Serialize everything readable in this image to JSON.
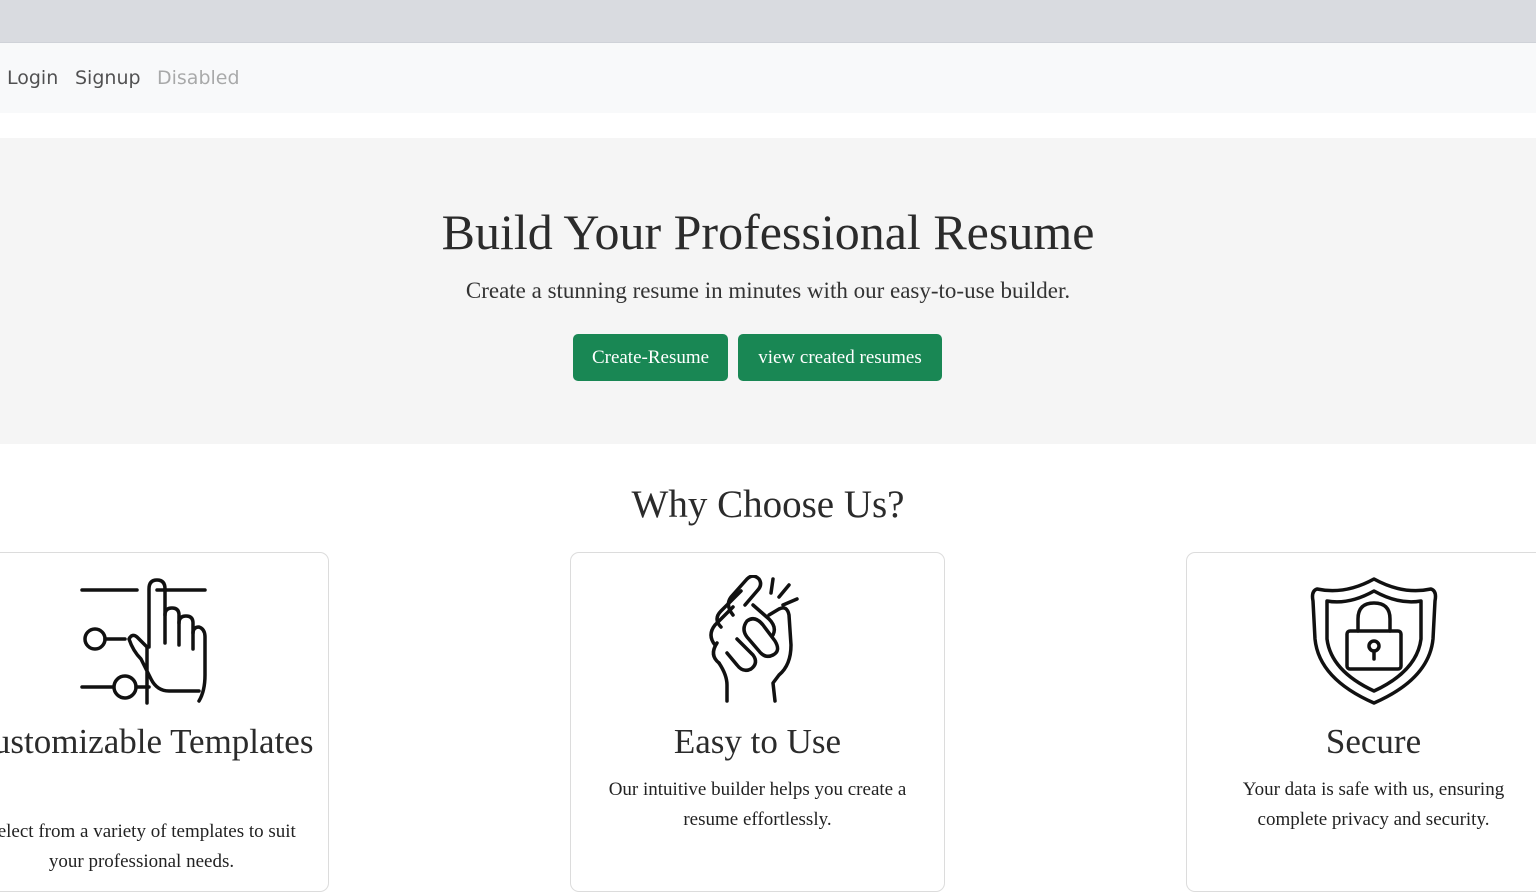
{
  "nav": {
    "login": "Login",
    "signup": "Signup",
    "disabled": "Disabled"
  },
  "hero": {
    "title": "Build Your Professional Resume",
    "subtitle": "Create a stunning resume in minutes with our easy-to-use builder.",
    "primary_button": "Create-Resume",
    "secondary_button": "view created resumes"
  },
  "features": {
    "title": "Why Choose Us?",
    "cards": [
      {
        "icon": "hand-slider-icon",
        "title": "Customizable Templates",
        "text": "Select from a variety of templates to suit your professional needs."
      },
      {
        "icon": "crossed-fingers-icon",
        "title": "Easy to Use",
        "text": "Our intuitive builder helps you create a resume effortlessly."
      },
      {
        "icon": "shield-lock-icon",
        "title": "Secure",
        "text": "Your data is safe with us, ensuring complete privacy and security."
      }
    ]
  },
  "colors": {
    "button_green": "#198754",
    "hero_background": "#f5f5f5",
    "navbar_background": "#f8f9fa"
  }
}
